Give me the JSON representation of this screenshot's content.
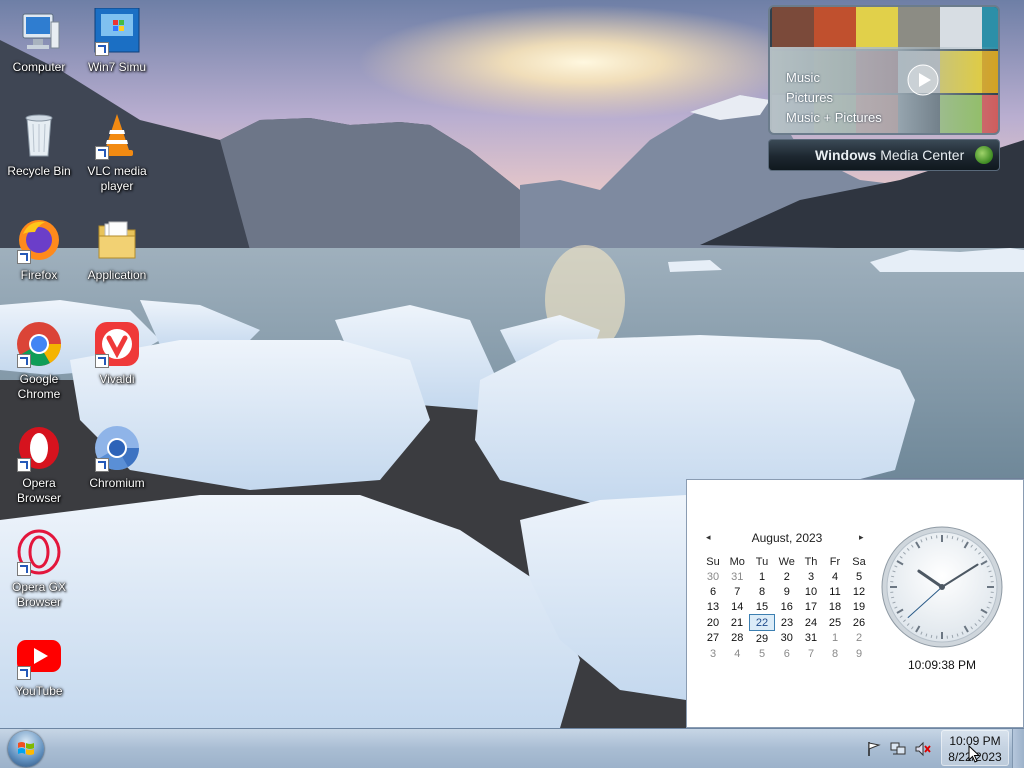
{
  "desktop": {
    "icons": [
      {
        "label": "Computer",
        "icon": "computer-icon",
        "shortcut": false
      },
      {
        "label": "Win7 Simu",
        "icon": "win7-simu-icon",
        "shortcut": true
      },
      {
        "label": "Recycle Bin",
        "icon": "recycle-bin-icon",
        "shortcut": false
      },
      {
        "label": "VLC media player",
        "icon": "vlc-icon",
        "shortcut": true
      },
      {
        "label": "Firefox",
        "icon": "firefox-icon",
        "shortcut": true
      },
      {
        "label": "Application",
        "icon": "folder-icon",
        "shortcut": false
      },
      {
        "label": "Google Chrome",
        "icon": "chrome-icon",
        "shortcut": true
      },
      {
        "label": "Vivaldi",
        "icon": "vivaldi-icon",
        "shortcut": true
      },
      {
        "label": "Opera Browser",
        "icon": "opera-icon",
        "shortcut": true
      },
      {
        "label": "Chromium",
        "icon": "chromium-icon",
        "shortcut": true
      },
      {
        "label": "Opera GX Browser",
        "icon": "opera-gx-icon",
        "shortcut": true
      },
      {
        "label": "YouTube",
        "icon": "youtube-icon",
        "shortcut": true
      }
    ]
  },
  "media_center_gadget": {
    "menu": [
      "Music",
      "Pictures",
      "Music + Pictures"
    ],
    "bar_label_bold": "Windows",
    "bar_label_rest": " Media Center"
  },
  "calendar": {
    "month_title": "August, 2023",
    "prev_symbol": "◂",
    "next_symbol": "▸",
    "weekdays": [
      "Su",
      "Mo",
      "Tu",
      "We",
      "Th",
      "Fr",
      "Sa"
    ],
    "weeks": [
      [
        "30",
        "31",
        "1",
        "2",
        "3",
        "4",
        "5"
      ],
      [
        "6",
        "7",
        "8",
        "9",
        "10",
        "11",
        "12"
      ],
      [
        "13",
        "14",
        "15",
        "16",
        "17",
        "18",
        "19"
      ],
      [
        "20",
        "21",
        "22",
        "23",
        "24",
        "25",
        "26"
      ],
      [
        "27",
        "28",
        "29",
        "30",
        "31",
        "1",
        "2"
      ],
      [
        "3",
        "4",
        "5",
        "6",
        "7",
        "8",
        "9"
      ]
    ],
    "today": "22"
  },
  "clock": {
    "time_text": "10:09:38 PM",
    "hour": 22,
    "minute": 9,
    "second": 38
  },
  "taskbar": {
    "tray_time": "10:09 PM",
    "tray_date": "8/22/2023",
    "tray_icons": [
      "action-center-flag-icon",
      "network-icon",
      "volume-muted-icon"
    ]
  },
  "colors": {
    "accent": "#3c7fb1",
    "taskbar": "#a9bdd3"
  }
}
